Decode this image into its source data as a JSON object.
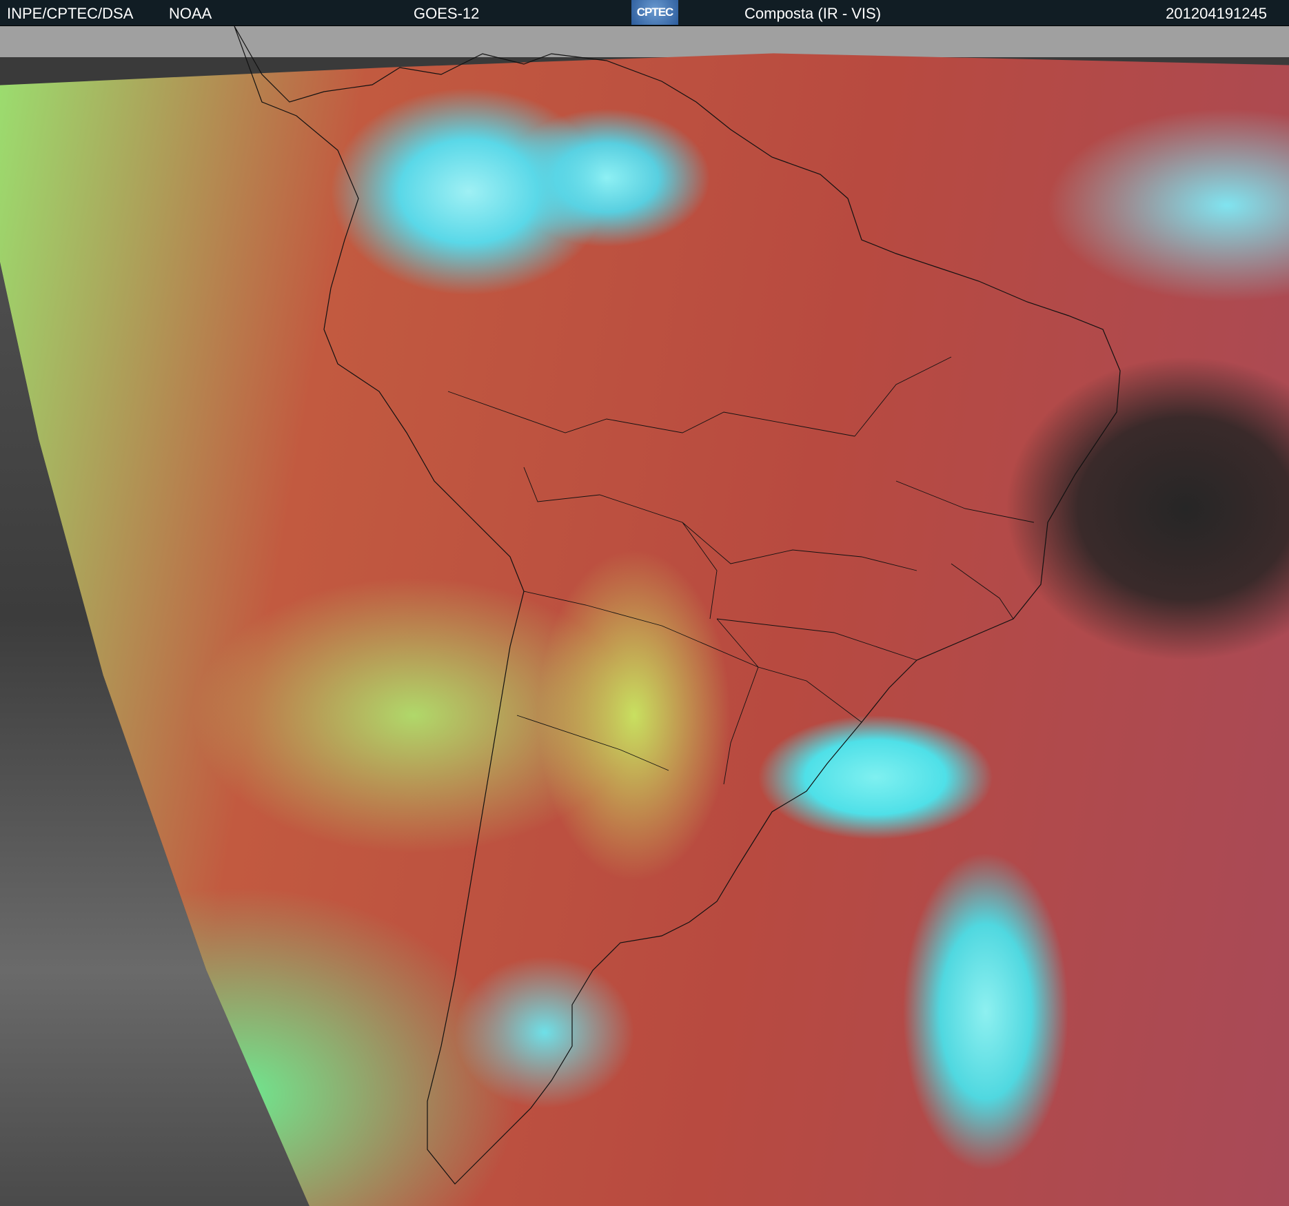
{
  "header": {
    "institution": "INPE/CPTEC/DSA",
    "agency": "NOAA",
    "satellite": "GOES-12",
    "logo_text": "CPTEC",
    "product": "Composta (IR - VIS)",
    "timestamp": "201204191245"
  }
}
